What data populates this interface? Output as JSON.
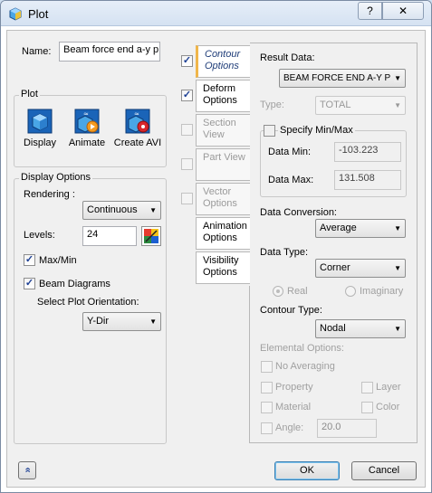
{
  "window": {
    "title": "Plot",
    "help_label": "?",
    "close_label": "✕"
  },
  "name": {
    "label": "Name:",
    "value": "Beam force end a-y p"
  },
  "plot_group": {
    "title": "Plot",
    "display_label": "Display",
    "animate_label": "Animate",
    "create_avi_label": "Create AVI"
  },
  "display_options": {
    "title": "Display Options",
    "rendering_label": "Rendering :",
    "rendering_value": "Continuous",
    "levels_label": "Levels:",
    "levels_value": "24",
    "maxmin_label": "Max/Min",
    "beam_diagrams_label": "Beam Diagrams",
    "orientation_label": "Select Plot Orientation:",
    "orientation_value": "Y-Dir"
  },
  "tabs": [
    {
      "label": "Contour\nOptions",
      "checked": true,
      "state": "active"
    },
    {
      "label": "Deform\nOptions",
      "checked": true,
      "state": "normal"
    },
    {
      "label": "Section\nView",
      "checked": false,
      "state": "disabled"
    },
    {
      "label": "Part View",
      "checked": false,
      "state": "disabled"
    },
    {
      "label": "Vector\nOptions",
      "checked": false,
      "state": "disabled"
    },
    {
      "label": "Animation\nOptions",
      "state": "normal"
    },
    {
      "label": "Visibility\nOptions",
      "state": "normal"
    }
  ],
  "contour": {
    "result_data_label": "Result Data:",
    "result_data_value": "BEAM FORCE END A-Y P",
    "type_label": "Type:",
    "type_value": "TOTAL",
    "specify_minmax_label": "Specify Min/Max",
    "data_min_label": "Data Min:",
    "data_min_value": "-103.223",
    "data_max_label": "Data Max:",
    "data_max_value": "131.508",
    "data_conversion_label": "Data Conversion:",
    "data_conversion_value": "Average",
    "data_type_label": "Data Type:",
    "data_type_value": "Corner",
    "real_label": "Real",
    "imaginary_label": "Imaginary",
    "contour_type_label": "Contour Type:",
    "contour_type_value": "Nodal",
    "elemental_options_label": "Elemental Options:",
    "no_averaging_label": "No Averaging",
    "property_label": "Property",
    "layer_label": "Layer",
    "material_label": "Material",
    "color_label": "Color",
    "angle_label": "Angle:",
    "angle_value": "20.0"
  },
  "footer": {
    "ok_label": "OK",
    "cancel_label": "Cancel",
    "collapse_label": "«"
  },
  "colors": {
    "accent": "#f0b64a",
    "titlebar": "#dbe6f3"
  }
}
